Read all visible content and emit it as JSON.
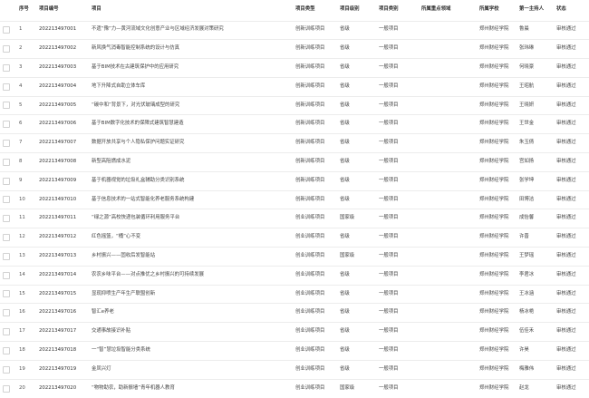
{
  "columns": {
    "index": "序号",
    "code": "项目编号",
    "name": "项目",
    "type": "项目类型",
    "level": "项目级别",
    "category": "项目类别",
    "field": "所属重点领域",
    "school": "所属学校",
    "leader": "第一主持人",
    "status": "状态"
  },
  "rows": [
    {
      "index": "1",
      "code": "202213497001",
      "name": "不遗“豫”力—黄河流域文化创意产业与区域经济发展对策研究",
      "type": "创新训练项目",
      "level": "省级",
      "category": "一般项目",
      "field": "",
      "school": "郑州财经学院",
      "leader": "鲁晨",
      "status": "审核通过"
    },
    {
      "index": "2",
      "code": "202213497002",
      "name": "新风换气消毒智能控制系统的设计与仿真",
      "type": "创新训练项目",
      "level": "省级",
      "category": "一般项目",
      "field": "",
      "school": "郑州财经学院",
      "leader": "张玮琳",
      "status": "审核通过"
    },
    {
      "index": "3",
      "code": "202213497003",
      "name": "基于BIM技术在古建筑保护中的应用研究",
      "type": "创新训练项目",
      "level": "省级",
      "category": "一般项目",
      "field": "",
      "school": "郑州财经学院",
      "leader": "何晓豪",
      "status": "审核通过"
    },
    {
      "index": "4",
      "code": "202213497004",
      "name": "地下升降式自助立体车库",
      "type": "创新训练项目",
      "level": "省级",
      "category": "一般项目",
      "field": "",
      "school": "郑州财经学院",
      "leader": "王昭航",
      "status": "审核通过"
    },
    {
      "index": "5",
      "code": "202213497005",
      "name": "“碳中和”背景下，对光伏玻璃成型的研究",
      "type": "创新训练项目",
      "level": "省级",
      "category": "一般项目",
      "field": "",
      "school": "郑州财经学院",
      "leader": "王晓妍",
      "status": "审核通过"
    },
    {
      "index": "6",
      "code": "202213497006",
      "name": "基于BIM数字化技术的保障式建筑智慧建造",
      "type": "创新训练项目",
      "level": "省级",
      "category": "一般项目",
      "field": "",
      "school": "郑州财经学院",
      "leader": "王世金",
      "status": "审核通过"
    },
    {
      "index": "7",
      "code": "202213497007",
      "name": "数据开放共享与个人隐私保护问题实证研究",
      "type": "创新训练项目",
      "level": "省级",
      "category": "一般项目",
      "field": "",
      "school": "郑州财经学院",
      "leader": "朱玉倩",
      "status": "审核通过"
    },
    {
      "index": "8",
      "code": "202213497008",
      "name": "新型高阻燃成水泥",
      "type": "创新训练项目",
      "level": "省级",
      "category": "一般项目",
      "field": "",
      "school": "郑州财经学院",
      "leader": "宫如扬",
      "status": "审核通过"
    },
    {
      "index": "9",
      "code": "202213497009",
      "name": "基于机器视觉的垃圾礼盒辅助分类识别系统",
      "type": "创新训练项目",
      "level": "省级",
      "category": "一般项目",
      "field": "",
      "school": "郑州财经学院",
      "leader": "张学坤",
      "status": "审核通过"
    },
    {
      "index": "10",
      "code": "202213497010",
      "name": "基于信息技术的一站式智能化养老服务系统构建",
      "type": "创新训练项目",
      "level": "省级",
      "category": "一般项目",
      "field": "",
      "school": "郑州财经学院",
      "leader": "田博洁",
      "status": "审核通过"
    },
    {
      "index": "11",
      "code": "202213497011",
      "name": "“绿之源”高校快递包装循环利用服务平台",
      "type": "创业训练项目",
      "level": "国家级",
      "category": "一般项目",
      "field": "",
      "school": "郑州财经学院",
      "leader": "成怡馨",
      "status": "审核通过"
    },
    {
      "index": "12",
      "code": "202213497012",
      "name": "红色摇篮，“桶”心不变",
      "type": "创业训练项目",
      "level": "省级",
      "category": "一般项目",
      "field": "",
      "school": "郑州财经学院",
      "leader": "许晋",
      "status": "审核通过"
    },
    {
      "index": "13",
      "code": "202213497013",
      "name": "乡村振兴——固收后发智能站",
      "type": "创业训练项目",
      "level": "国家级",
      "category": "一般项目",
      "field": "",
      "school": "郑州财经学院",
      "leader": "王梦瑶",
      "status": "审核通过"
    },
    {
      "index": "14",
      "code": "202213497014",
      "name": "农农乡味平台——对点推优之乡村振兴的可持续发展",
      "type": "创业训练项目",
      "level": "省级",
      "category": "一般项目",
      "field": "",
      "school": "郑州财经学院",
      "leader": "李君冰",
      "status": "审核通过"
    },
    {
      "index": "15",
      "code": "202213497015",
      "name": "显现抑喷生产年生产联盟创新",
      "type": "创业训练项目",
      "level": "省级",
      "category": "一般项目",
      "field": "",
      "school": "郑州财经学院",
      "leader": "王冰涵",
      "status": "审核通过"
    },
    {
      "index": "16",
      "code": "202213497016",
      "name": "智汇e养老",
      "type": "创业训练项目",
      "level": "省级",
      "category": "一般项目",
      "field": "",
      "school": "郑州财经学院",
      "leader": "杨冰艳",
      "status": "审核通过"
    },
    {
      "index": "17",
      "code": "202213497017",
      "name": "交通事故接识补贴",
      "type": "创业训练项目",
      "level": "省级",
      "category": "一般项目",
      "field": "",
      "school": "郑州财经学院",
      "leader": "伍佳禾",
      "status": "审核通过"
    },
    {
      "index": "18",
      "code": "202213497018",
      "name": "一“智”慧垃圾智能分类系统",
      "type": "创业训练项目",
      "level": "省级",
      "category": "一般项目",
      "field": "",
      "school": "郑州财经学院",
      "leader": "许昊",
      "status": "审核通过"
    },
    {
      "index": "19",
      "code": "202213497019",
      "name": "金凤兴灯",
      "type": "创业训练项目",
      "level": "省级",
      "category": "一般项目",
      "field": "",
      "school": "郑州财经学院",
      "leader": "梅雅伟",
      "status": "审核通过"
    },
    {
      "index": "20",
      "code": "202213497020",
      "name": "“物物助农，助新振墙”青年机器人教育",
      "type": "创业训练项目",
      "level": "国家级",
      "category": "一般项目",
      "field": "",
      "school": "郑州财经学院",
      "leader": "赵龙",
      "status": "审核通过"
    }
  ]
}
